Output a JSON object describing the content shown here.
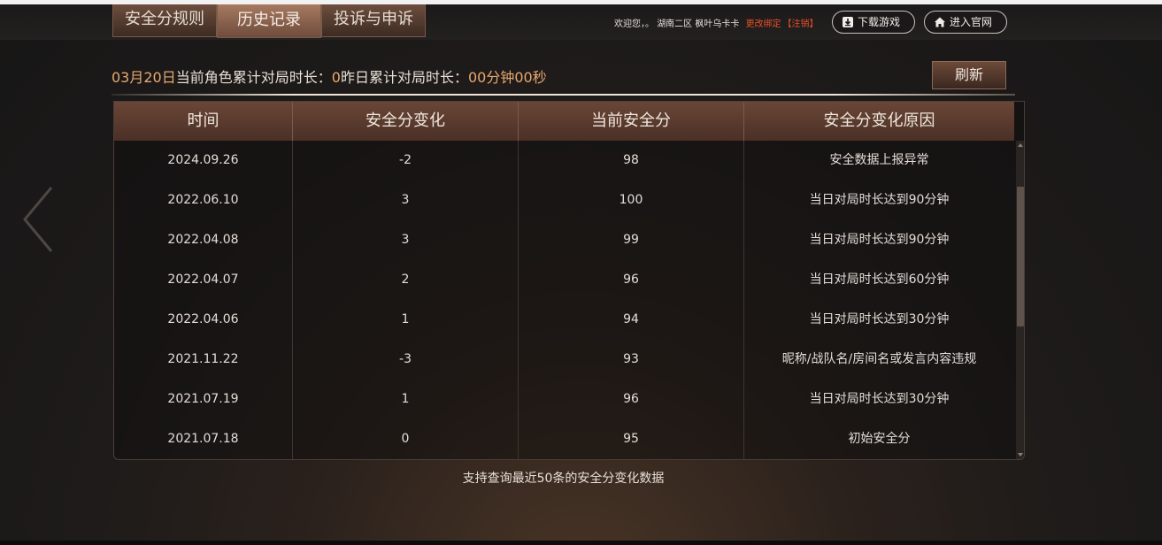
{
  "tabs": [
    {
      "label": "安全分规则"
    },
    {
      "label": "历史记录"
    },
    {
      "label": "投诉与申诉"
    }
  ],
  "header": {
    "welcome_prefix": "欢迎您，。",
    "server": "湖南二区",
    "role": "枫叶乌卡卡",
    "change_bind": "更改绑定",
    "logout": "【注销】",
    "download_label": "下载游戏",
    "site_label": "进入官网"
  },
  "info": {
    "date": "03月20日",
    "today_label": "当前角色累计对局时长：",
    "today_value": "0",
    "yesterday_label": "昨日累计对局时长：",
    "yesterday_value": "00分钟00秒"
  },
  "refresh_label": "刷新",
  "table": {
    "headers": [
      "时间",
      "安全分变化",
      "当前安全分",
      "安全分变化原因"
    ],
    "rows": [
      [
        "2024.09.26",
        "-2",
        "98",
        "安全数据上报异常"
      ],
      [
        "2022.06.10",
        "3",
        "100",
        "当日对局时长达到90分钟"
      ],
      [
        "2022.04.08",
        "3",
        "99",
        "当日对局时长达到90分钟"
      ],
      [
        "2022.04.07",
        "2",
        "96",
        "当日对局时长达到60分钟"
      ],
      [
        "2022.04.06",
        "1",
        "94",
        "当日对局时长达到30分钟"
      ],
      [
        "2021.11.22",
        "-3",
        "93",
        "昵称/战队名/房间名或发言内容违规"
      ],
      [
        "2021.07.19",
        "1",
        "96",
        "当日对局时长达到30分钟"
      ],
      [
        "2021.07.18",
        "0",
        "95",
        "初始安全分"
      ]
    ]
  },
  "footnote": "支持查询最近50条的安全分变化数据",
  "colors": {
    "accent": "#e8a86e",
    "warning": "#e8502a",
    "header_bg": "#5a3a2d"
  }
}
